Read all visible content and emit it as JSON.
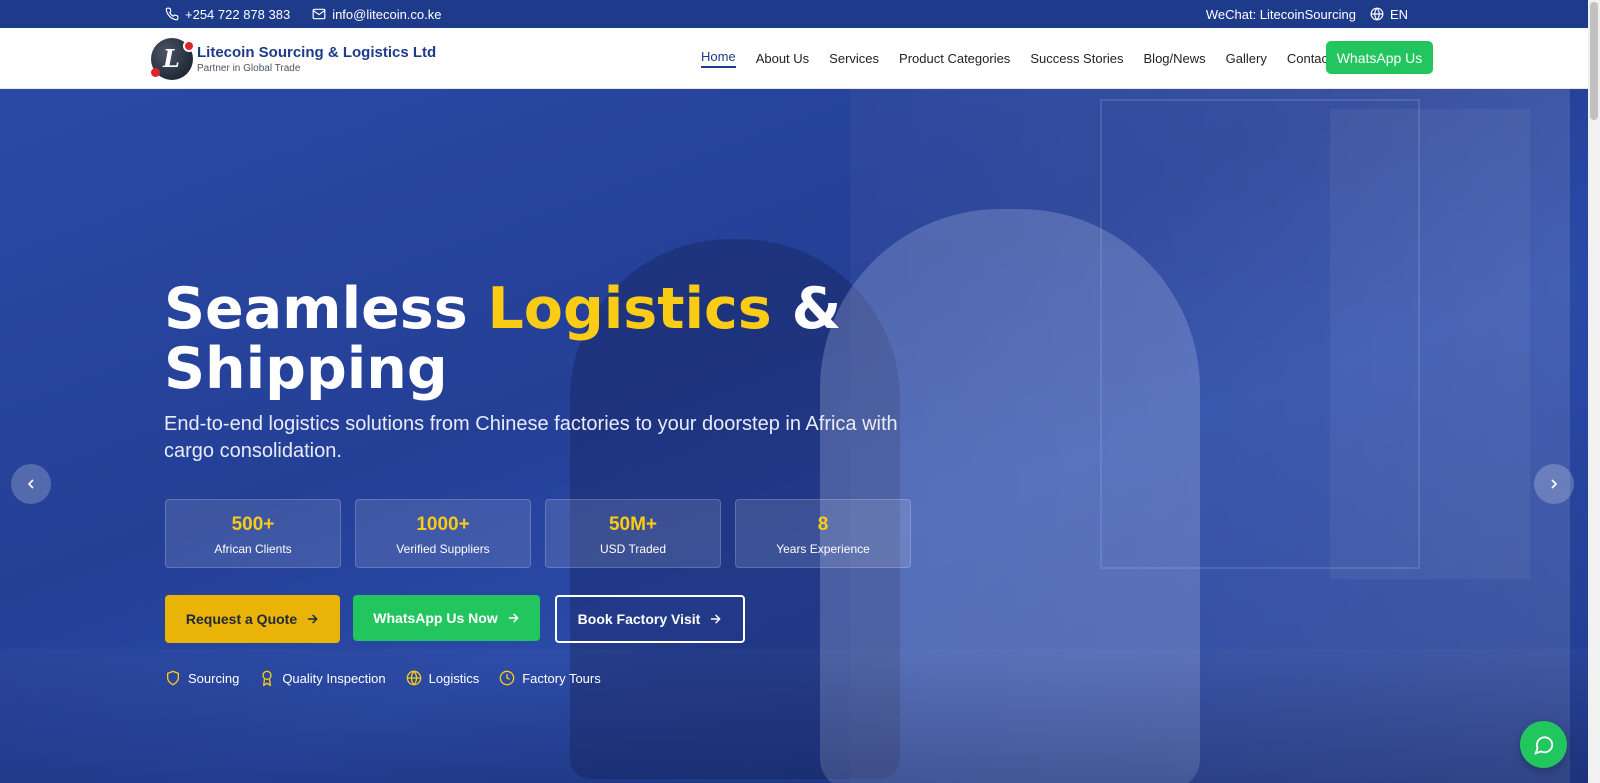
{
  "topbar": {
    "phone": "+254 722 878 383",
    "email": "info@litecoin.co.ke",
    "wechat": "WeChat: LitecoinSourcing",
    "language": "EN"
  },
  "header": {
    "brand_name": "Litecoin Sourcing & Logistics Ltd",
    "brand_tagline": "Partner in Global Trade",
    "nav": [
      {
        "label": "Home",
        "active": true
      },
      {
        "label": "About Us"
      },
      {
        "label": "Services"
      },
      {
        "label": "Product Categories"
      },
      {
        "label": "Success Stories"
      },
      {
        "label": "Blog/News"
      },
      {
        "label": "Gallery"
      },
      {
        "label": "Contact Us"
      }
    ],
    "whatsapp_label": "WhatsApp Us"
  },
  "hero": {
    "title_part1": "Seamless ",
    "title_highlight": "Logistics",
    "title_part2": " & Shipping",
    "subtitle": "End-to-end logistics solutions from Chinese factories to your doorstep in Africa with cargo consolidation.",
    "stats": [
      {
        "value": "500+",
        "label": "African Clients"
      },
      {
        "value": "1000+",
        "label": "Verified Suppliers"
      },
      {
        "value": "50M+",
        "label": "USD Traded"
      },
      {
        "value": "8",
        "label": "Years Experience"
      }
    ],
    "cta_quote": "Request a Quote",
    "cta_whatsapp": "WhatsApp Us Now",
    "cta_visit": "Book Factory Visit",
    "features": [
      {
        "label": "Sourcing",
        "icon": "shield-icon"
      },
      {
        "label": "Quality Inspection",
        "icon": "award-icon"
      },
      {
        "label": "Logistics",
        "icon": "globe-icon"
      },
      {
        "label": "Factory Tours",
        "icon": "clock-icon"
      }
    ]
  },
  "colors": {
    "primary": "#1e3a8a",
    "accent": "#facc15",
    "whatsapp": "#22c55e",
    "quote_button": "#eab308"
  }
}
